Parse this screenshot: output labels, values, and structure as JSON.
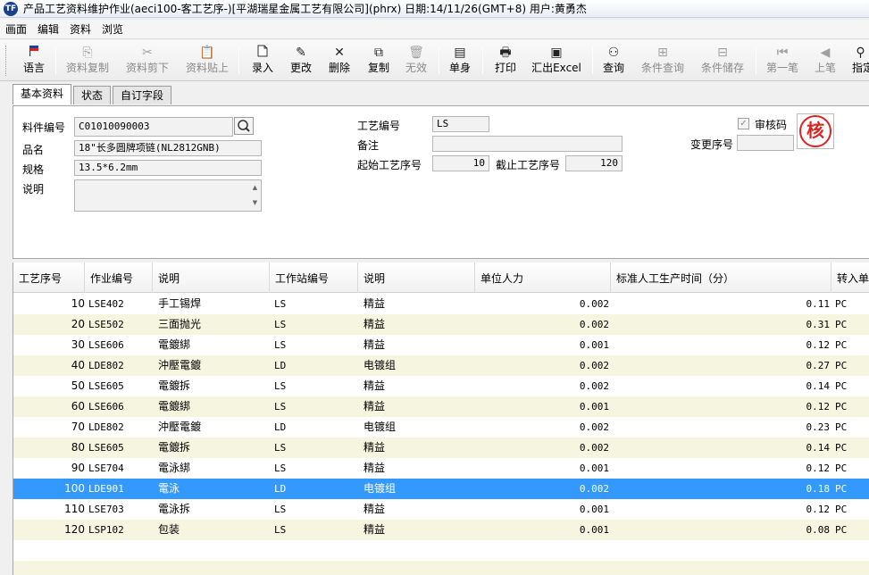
{
  "window": {
    "logo": "TF",
    "title": "产品工艺资料维护作业(aeci100-客工艺序-)[平湖瑞星金属工艺有限公司](phrx)  日期:14/11/26(GMT+8)  用户:黄勇杰"
  },
  "menu": [
    {
      "label": "画面"
    },
    {
      "label": "编辑"
    },
    {
      "label": "资料"
    },
    {
      "label": "浏览"
    }
  ],
  "toolbar": {
    "language": {
      "label": "语言",
      "icon": "flag-icon"
    },
    "copy_data": {
      "label": "资料复制",
      "icon": "copy-icon"
    },
    "cut_data": {
      "label": "资料剪下",
      "icon": "scissors-icon"
    },
    "paste_data": {
      "label": "资料贴上",
      "icon": "paste-icon"
    },
    "new": {
      "label": "录入",
      "icon": "new-document-icon"
    },
    "modify": {
      "label": "更改",
      "icon": "pencil-icon"
    },
    "delete": {
      "label": "删除",
      "icon": "delete-icon"
    },
    "duplicate": {
      "label": "复制",
      "icon": "duplicate-icon"
    },
    "invalidate": {
      "label": "无效",
      "icon": "trash-icon"
    },
    "single": {
      "label": "单身",
      "icon": "single-body-icon"
    },
    "print": {
      "label": "打印",
      "icon": "printer-icon"
    },
    "export": {
      "label": "汇出Excel",
      "icon": "excel-export-icon"
    },
    "query": {
      "label": "查询",
      "icon": "binoculars-icon"
    },
    "cond_query": {
      "label": "条件查询",
      "icon": "condition-query-icon"
    },
    "cond_save": {
      "label": "条件储存",
      "icon": "condition-save-icon"
    },
    "first": {
      "label": "第一笔",
      "icon": "first-record-icon"
    },
    "prev": {
      "label": "上笔",
      "icon": "prev-record-icon"
    },
    "specify": {
      "label": "指定",
      "icon": "pin-icon"
    }
  },
  "tabs": [
    {
      "label": "基本资料"
    },
    {
      "label": "状态"
    },
    {
      "label": "自订字段"
    }
  ],
  "form": {
    "item_no_label": "料件编号",
    "item_no": "C01010090003",
    "name_label": "品名",
    "name": "18\"长多圆牌项链(NL2812GNB)",
    "spec_label": "规格",
    "spec": "13.5*6.2mm",
    "desc_label": "说明",
    "desc": "",
    "process_no_label": "工艺编号",
    "process_no": "LS",
    "remark_label": "备注",
    "remark": "",
    "start_seq_label": "起始工艺序号",
    "start_seq": "10",
    "end_seq_label": "截止工艺序号",
    "end_seq": "120",
    "approve_label": "审核码",
    "approve_checked": true,
    "change_seq_label": "变更序号",
    "change_seq": "",
    "stamp_text": "核"
  },
  "grid": {
    "headers": [
      "工艺序号",
      "作业编号",
      "说明",
      "工作站编号",
      "说明",
      "单位人力",
      "标准人工生产时间（分）",
      "转入单"
    ],
    "selected_index": 9,
    "rows": [
      {
        "seq": "10",
        "op": "LSE402",
        "desc": "手工锡焊",
        "station": "LS",
        "station_desc": "精益",
        "manpower": "0.002",
        "std_time": "0.11",
        "unit": "PC"
      },
      {
        "seq": "20",
        "op": "LSE502",
        "desc": "三面抛光",
        "station": "LS",
        "station_desc": "精益",
        "manpower": "0.002",
        "std_time": "0.31",
        "unit": "PC"
      },
      {
        "seq": "30",
        "op": "LSE606",
        "desc": "電鍍綁",
        "station": "LS",
        "station_desc": "精益",
        "manpower": "0.001",
        "std_time": "0.12",
        "unit": "PC"
      },
      {
        "seq": "40",
        "op": "LDE802",
        "desc": "沖壓電鍍",
        "station": "LD",
        "station_desc": "电镀组",
        "manpower": "0.002",
        "std_time": "0.27",
        "unit": "PC"
      },
      {
        "seq": "50",
        "op": "LSE605",
        "desc": "電鍍拆",
        "station": "LS",
        "station_desc": "精益",
        "manpower": "0.002",
        "std_time": "0.14",
        "unit": "PC"
      },
      {
        "seq": "60",
        "op": "LSE606",
        "desc": "電鍍綁",
        "station": "LS",
        "station_desc": "精益",
        "manpower": "0.001",
        "std_time": "0.12",
        "unit": "PC"
      },
      {
        "seq": "70",
        "op": "LDE802",
        "desc": "沖壓電鍍",
        "station": "LD",
        "station_desc": "电镀组",
        "manpower": "0.002",
        "std_time": "0.23",
        "unit": "PC"
      },
      {
        "seq": "80",
        "op": "LSE605",
        "desc": "電鍍拆",
        "station": "LS",
        "station_desc": "精益",
        "manpower": "0.002",
        "std_time": "0.14",
        "unit": "PC"
      },
      {
        "seq": "90",
        "op": "LSE704",
        "desc": "電泳綁",
        "station": "LS",
        "station_desc": "精益",
        "manpower": "0.001",
        "std_time": "0.12",
        "unit": "PC"
      },
      {
        "seq": "100",
        "op": "LDE901",
        "desc": "電泳",
        "station": "LD",
        "station_desc": "电镀组",
        "manpower": "0.002",
        "std_time": "0.18",
        "unit": "PC"
      },
      {
        "seq": "110",
        "op": "LSE703",
        "desc": "電泳拆",
        "station": "LS",
        "station_desc": "精益",
        "manpower": "0.001",
        "std_time": "0.12",
        "unit": "PC"
      },
      {
        "seq": "120",
        "op": "LSP102",
        "desc": "包装",
        "station": "LS",
        "station_desc": "精益",
        "manpower": "0.001",
        "std_time": "0.08",
        "unit": "PC"
      }
    ]
  },
  "colors": {
    "selected_row": "#3399ff",
    "alt_row": "#f6f5e0",
    "stamp": "#dd2222"
  }
}
